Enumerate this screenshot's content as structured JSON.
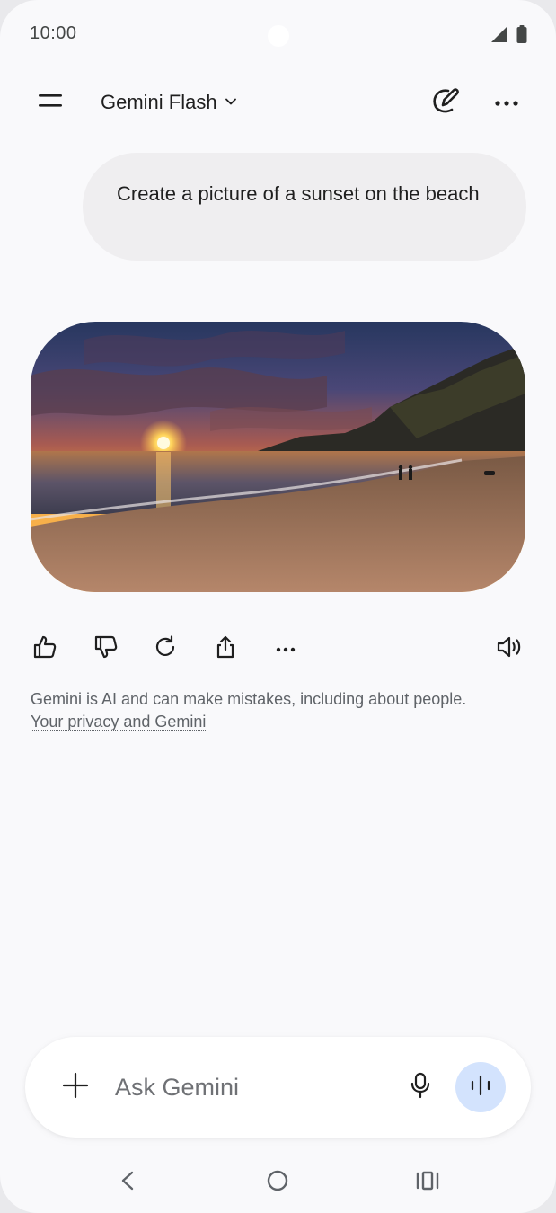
{
  "status_bar": {
    "time": "10:00",
    "icons": [
      "signal-icon",
      "battery-icon"
    ]
  },
  "top_bar": {
    "model_name": "Gemini Flash",
    "icons": [
      "menu-icon",
      "chevron-down-icon",
      "new-chat-edit-icon",
      "more-horizontal-icon"
    ]
  },
  "conversation": {
    "user_prompt": "Create a picture of a sunset on the beach",
    "response_image": {
      "subject": "sunset on the beach"
    },
    "actions": [
      {
        "name": "thumbs-up",
        "icon": "thumbs-up-icon"
      },
      {
        "name": "thumbs-down",
        "icon": "thumbs-down-icon"
      },
      {
        "name": "regenerate",
        "icon": "refresh-icon"
      },
      {
        "name": "share",
        "icon": "share-icon"
      },
      {
        "name": "more",
        "icon": "more-horizontal-icon"
      },
      {
        "name": "read-aloud",
        "icon": "speaker-icon"
      }
    ]
  },
  "disclaimer": {
    "text": "Gemini is AI and can make mistakes, including about people.",
    "link_label": "Your privacy and Gemini"
  },
  "input_bar": {
    "placeholder": "Ask Gemini",
    "value": "",
    "icons": [
      "plus-icon",
      "mic-icon",
      "live-audio-icon"
    ]
  },
  "nav_bar": {
    "icons": [
      "back-icon",
      "home-icon",
      "recents-icon"
    ]
  },
  "colors": {
    "background": "#f9f9fb",
    "user_bubble": "#efeef0",
    "live_button": "#d3e3fd",
    "text_primary": "#1f1f1f",
    "text_secondary": "#5f6368"
  }
}
